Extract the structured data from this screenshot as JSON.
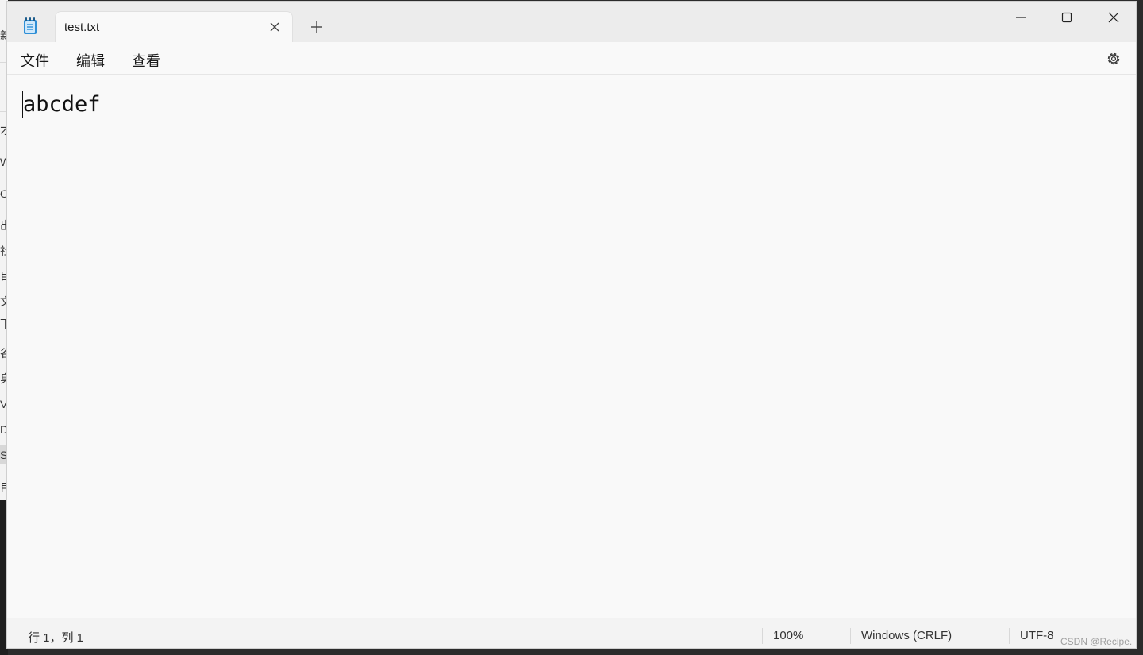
{
  "background_window": {
    "glyphs": [
      "新",
      "才",
      "W",
      "O",
      "出",
      "社",
      "目",
      "文",
      "下",
      "谷",
      "臭",
      "V",
      "D",
      "S",
      "目"
    ]
  },
  "tab": {
    "title": "test.txt",
    "close_icon": "close-icon"
  },
  "titlebar": {
    "app_icon": "notepad-icon",
    "new_tab_icon": "plus-icon",
    "minimize_icon": "minimize-icon",
    "maximize_icon": "maximize-icon",
    "close_icon": "close-icon"
  },
  "menu": {
    "file": "文件",
    "edit": "编辑",
    "view": "查看",
    "settings_icon": "gear-icon"
  },
  "editor": {
    "content": "abcdef"
  },
  "status": {
    "position": "行 1，列 1",
    "zoom": "100%",
    "line_ending": "Windows (CRLF)",
    "encoding": "UTF-8"
  },
  "watermark": "CSDN @Recipe.",
  "colors": {
    "app_icon_blue": "#2f8fd6",
    "window_bg": "#f9f9f9",
    "titlebar_bg": "#ececec"
  }
}
